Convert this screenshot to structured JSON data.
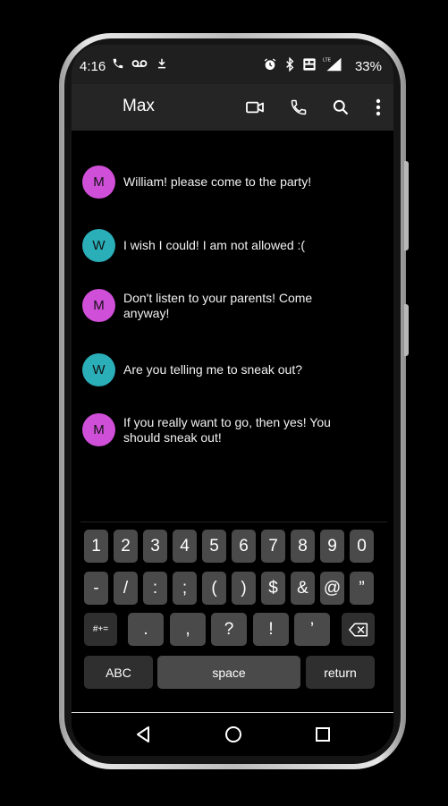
{
  "status_bar": {
    "time": "4:16",
    "battery": "33%",
    "left_icons": [
      "phone-icon",
      "voicemail-icon",
      "download-icon"
    ],
    "right_icons": [
      "alarm-icon",
      "bluetooth-icon",
      "volte-icon",
      "lte-signal-icon"
    ]
  },
  "app_bar": {
    "title": "Max",
    "actions": [
      "video-call-icon",
      "phone-call-icon",
      "search-icon",
      "more-vert-icon"
    ]
  },
  "messages": [
    {
      "initial": "M",
      "color": "#d04fd8",
      "text": "William! please come to the party!"
    },
    {
      "initial": "W",
      "color": "#2aaeb8",
      "text": "I wish I could! I am not allowed :("
    },
    {
      "initial": "M",
      "color": "#d04fd8",
      "text": "Don't listen to your parents! Come anyway!"
    },
    {
      "initial": "W",
      "color": "#2aaeb8",
      "text": "Are you telling me to sneak out?"
    },
    {
      "initial": "M",
      "color": "#d04fd8",
      "text": "If you really want to go, then yes! You should sneak out!"
    }
  ],
  "keyboard": {
    "numbers": [
      "1",
      "2",
      "3",
      "4",
      "5",
      "6",
      "7",
      "8",
      "9",
      "0"
    ],
    "symbols": [
      "-",
      "/",
      ":",
      ";",
      "(",
      ")",
      "$",
      "&",
      "@",
      "”"
    ],
    "row3": {
      "mode": "#+=",
      "keys": [
        ".",
        ",",
        "?",
        "!",
        "’"
      ],
      "backspace": "backspace-icon"
    },
    "abc": "ABC",
    "space": "space",
    "return": "return"
  },
  "nav_bar": [
    "back-icon",
    "home-icon",
    "recents-icon"
  ]
}
